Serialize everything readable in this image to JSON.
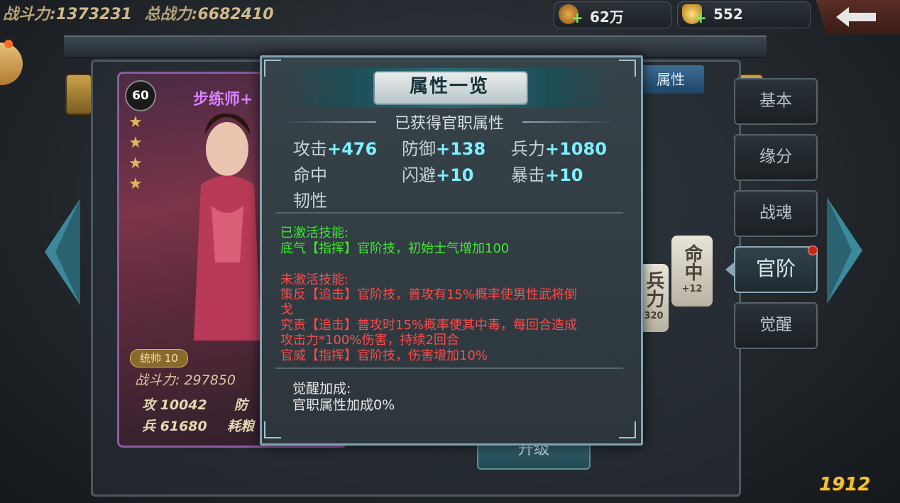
{
  "header": {
    "combat_label": "战斗力:",
    "combat_value": "1373231",
    "total_label": "总战力:",
    "total_value": "6682410",
    "coin_value": "62万",
    "ingot_value": "552"
  },
  "hero_card": {
    "level": "60",
    "name": "步练师+",
    "rank_badge": "统帅 10",
    "power_label": "战斗力:",
    "power_value": "297850",
    "atk_label": "攻",
    "atk_value": "10042",
    "def_label": "防",
    "hp_label": "兵",
    "hp_value": "61680",
    "food_label": "耗粮",
    "stars": 4
  },
  "side_tabs": [
    {
      "label": "基本"
    },
    {
      "label": "缘分"
    },
    {
      "label": "战魂"
    },
    {
      "label": "官阶"
    },
    {
      "label": "觉醒"
    }
  ],
  "behind_modal": {
    "attr_tab": "属性",
    "chip1": "命中",
    "chip1_sub": "+12",
    "chip2": "兵力",
    "chip2_sub": "320",
    "upgrade_button": "升级"
  },
  "modal": {
    "title": "属性一览",
    "section_title": "已获得官职属性",
    "stats": [
      {
        "label": "攻击",
        "value": "+476"
      },
      {
        "label": "防御",
        "value": "+138"
      },
      {
        "label": "兵力",
        "value": "+1080"
      },
      {
        "label": "命中",
        "value": ""
      },
      {
        "label": "闪避",
        "value": "+10"
      },
      {
        "label": "暴击",
        "value": "+10"
      },
      {
        "label": "韧性",
        "value": ""
      }
    ],
    "active_skills_heading": "已激活技能:",
    "active_skills": [
      "底气【指挥】官阶技，初始士气增加100"
    ],
    "inactive_skills_heading": "未激活技能:",
    "inactive_skills": [
      "策反【追击】官阶技，普攻有15%概率使男性武将倒",
      "戈",
      "究责【追击】普攻时15%概率使其中毒，每回合造成",
      "攻击力*100%伤害，持续2回合",
      "官威【指挥】官阶技，伤害增加10%"
    ],
    "awaken_heading": "觉醒加成:",
    "awaken_text": "官职属性加成0%"
  },
  "watermark": "1912"
}
